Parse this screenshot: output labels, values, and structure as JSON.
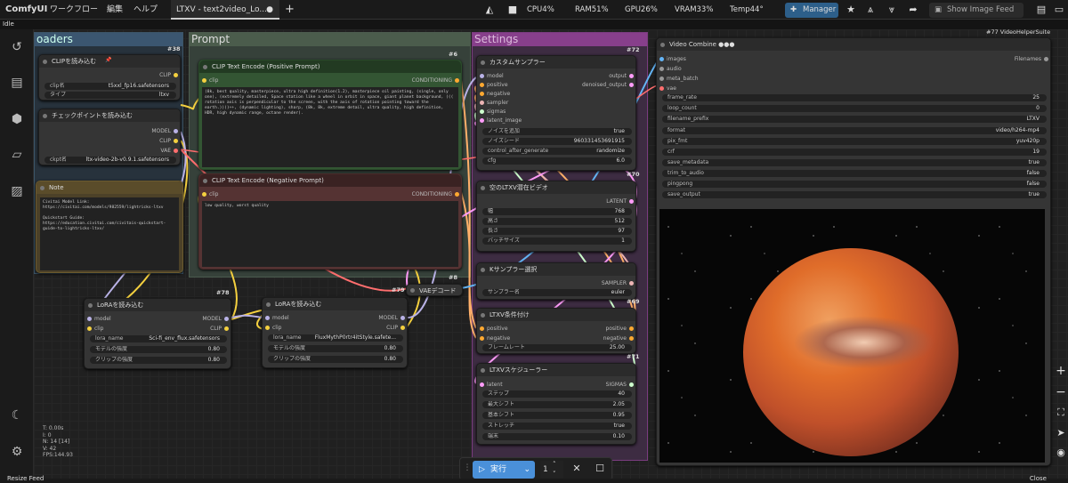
{
  "app": {
    "logo": "ComfyUI",
    "menu": [
      "ワークフロー",
      "編集",
      "ヘルプ"
    ],
    "tab": "LTXV - text2video_Lo...",
    "status": "Idle"
  },
  "stats": {
    "cpu": "CPU4%",
    "ram": "RAM51%",
    "gpu": "GPU26%",
    "vram": "VRAM33%",
    "temp": "Temp44°"
  },
  "toolbar": {
    "manager": "Manager",
    "feed": "Show Image Feed"
  },
  "groups": {
    "loaders": "oaders",
    "prompt": "Prompt",
    "settings": "Settings"
  },
  "nodes": {
    "clip_loader": {
      "title": "CLIPを読み込む",
      "num": "#38",
      "out": "CLIP",
      "w1": {
        "label": "clip名",
        "value": "t5xxl_fp16.safetensors"
      },
      "w2": {
        "label": "タイプ",
        "value": "ltxv"
      }
    },
    "ckpt": {
      "title": "チェックポイントを読み込む",
      "outs": [
        "MODEL",
        "CLIP",
        "VAE"
      ],
      "w1": {
        "label": "ckpt名",
        "value": "ltx-video-2b-v0.9.1.safetensors"
      }
    },
    "note": {
      "title": "Note",
      "text": "Civitai Model Link:\nhttps://civitai.com/models/982559/lightricks-ltxv\n\nQuickstart Guide: https://education.civitai.com/civitais-quickstart-guide-to-lightricks-ltxv/"
    },
    "pos": {
      "title": "CLIP Text Encode (Positive Prompt)",
      "num": "#6",
      "in": "clip",
      "out": "CONDITIONING",
      "text": "(8k, best quality, masterpiece, ultra high definition(1.2), masterpiece oil painting, (single, only one), (extremely detailed, Space station like a wheel in orbit in space, giant planet background, ((( rotation axis is perpendicular to the screen, with the axis of rotation pointing toward the earth.))))++, (dynamic lighting), sharp, (8k, 8k, extreme detail, ultra quality, high definition, HDR, high dynamic range, octane render)."
    },
    "neg": {
      "title": "CLIP Text Encode (Negative Prompt)",
      "num": "#7",
      "in": "clip",
      "out": "CONDITIONING",
      "text": "low quality, worst quality"
    },
    "lora1": {
      "title": "LoRAを読み込む",
      "ins": [
        "model",
        "clip"
      ],
      "outs": [
        "MODEL",
        "CLIP"
      ],
      "w": [
        {
          "label": "lora_name",
          "value": "Sci-fi_env_flux.safetensors"
        },
        {
          "label": "モデルの強度",
          "value": "0.80"
        },
        {
          "label": "クリップの強度",
          "value": "0.80"
        }
      ]
    },
    "lora2": {
      "title": "LoRAを読み込む",
      "num": "#78",
      "ins": [
        "model",
        "clip"
      ],
      "outs": [
        "MODEL",
        "CLIP"
      ],
      "w": [
        {
          "label": "lora_name",
          "value": "FluxMythP0rtr4itStyle.safete..."
        },
        {
          "label": "モデルの強度",
          "value": "0.80"
        },
        {
          "label": "クリップの強度",
          "value": "0.80"
        }
      ]
    },
    "vae": {
      "title": "VAEデコード",
      "num": "#79",
      "num2": "#8"
    },
    "sampler": {
      "title": "カスタムサンプラー",
      "num": "#72",
      "ins": [
        "model",
        "positive",
        "negative",
        "sampler",
        "sigmas",
        "latent_image"
      ],
      "outs": [
        "output",
        "denoised_output"
      ],
      "w": [
        {
          "label": "ノイズを追加",
          "value": "true"
        },
        {
          "label": "ノイズシード",
          "value": "960331453691915"
        },
        {
          "label": "control_after_generate",
          "value": "randomize"
        },
        {
          "label": "cfg",
          "value": "6.0"
        }
      ]
    },
    "latent": {
      "title": "空のLTXV潜在ビデオ",
      "num": "#70",
      "out": "LATENT",
      "w": [
        {
          "label": "幅",
          "value": "768"
        },
        {
          "label": "高さ",
          "value": "512"
        },
        {
          "label": "長さ",
          "value": "97"
        },
        {
          "label": "バッチサイズ",
          "value": "1"
        }
      ]
    },
    "ksel": {
      "title": "Kサンプラー選択",
      "out": "SAMPLER",
      "w": [
        {
          "label": "サンプラー名",
          "value": "euler"
        }
      ]
    },
    "cond": {
      "title": "LTXV条件付け",
      "num": "#69",
      "ins": [
        "positive",
        "negative"
      ],
      "outs": [
        "positive",
        "negative"
      ],
      "w": [
        {
          "label": "フレームレート",
          "value": "25.00"
        }
      ]
    },
    "sched": {
      "title": "LTXVスケジューラー",
      "num": "#71",
      "in": "latent",
      "out": "SIGMAS",
      "w": [
        {
          "label": "ステップ",
          "value": "40"
        },
        {
          "label": "最大シフト",
          "value": "2.05"
        },
        {
          "label": "基本シフト",
          "value": "0.95"
        },
        {
          "label": "ストレッチ",
          "value": "true"
        },
        {
          "label": "端末",
          "value": "0.10"
        }
      ]
    },
    "combine": {
      "title": "Video Combine ●●●",
      "num": "#77 VideoHelperSuite",
      "ins": [
        "images",
        "audio",
        "meta_batch",
        "vae"
      ],
      "out": "Filenames",
      "w": [
        {
          "label": "frame_rate",
          "value": "25"
        },
        {
          "label": "loop_count",
          "value": "0"
        },
        {
          "label": "filename_prefix",
          "value": "LTXV"
        },
        {
          "label": "format",
          "value": "video/h264-mp4"
        },
        {
          "label": "pix_fmt",
          "value": "yuv420p"
        },
        {
          "label": "crf",
          "value": "19"
        },
        {
          "label": "save_metadata",
          "value": "true"
        },
        {
          "label": "trim_to_audio",
          "value": "false"
        },
        {
          "label": "pingpong",
          "value": "false"
        },
        {
          "label": "save_output",
          "value": "true"
        }
      ]
    }
  },
  "info": [
    "T: 0.00s",
    "I: 0",
    "N: 14 [14]",
    "V: 42",
    "FPS:144.93"
  ],
  "run": {
    "label": "実行",
    "count": "1"
  },
  "bottom": {
    "left": "Resize Feed",
    "right": "Close"
  }
}
